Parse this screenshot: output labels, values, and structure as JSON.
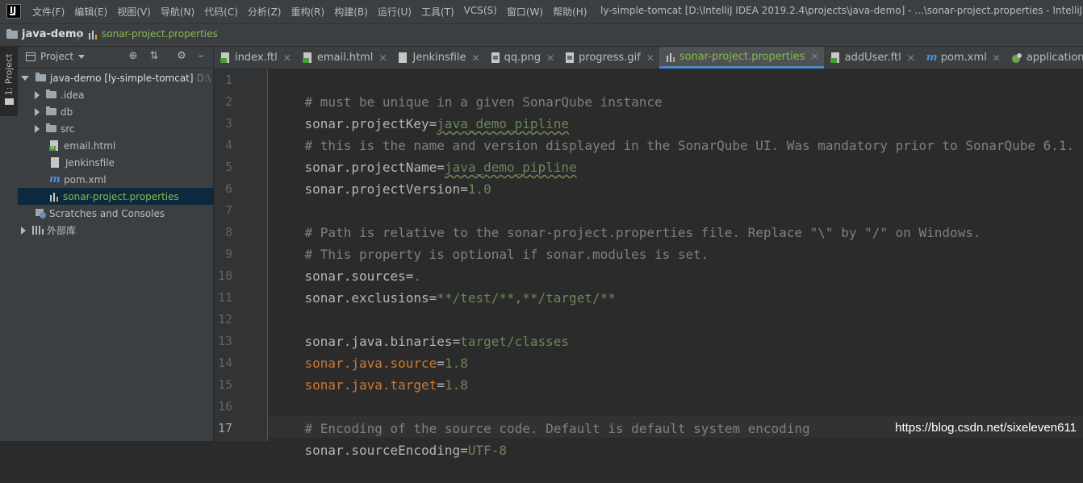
{
  "menubar": {
    "items": [
      "文件(F)",
      "编辑(E)",
      "视图(V)",
      "导航(N)",
      "代码(C)",
      "分析(Z)",
      "重构(R)",
      "构建(B)",
      "运行(U)",
      "工具(T)",
      "VCS(S)",
      "窗口(W)",
      "帮助(H)"
    ],
    "window_title": "ly-simple-tomcat [D:\\IntelliJ IDEA 2019.2.4\\projects\\java-demo] - ...\\sonar-project.properties - IntelliJ ID"
  },
  "navbar": {
    "project": "java-demo",
    "file": "sonar-project.properties"
  },
  "tool_stripe": {
    "project_label": "1: Project"
  },
  "project_panel": {
    "title": "Project",
    "tree": {
      "root_name": "java-demo [ly-simple-tomcat]",
      "root_hint": "D:\\",
      "items": [
        ".idea",
        "db",
        "src",
        "email.html",
        "Jenkinsfile",
        "pom.xml",
        "sonar-project.properties",
        "Scratches and Consoles",
        "外部库"
      ]
    }
  },
  "tabs": [
    "index.ftl",
    "email.html",
    "Jenkinsfile",
    "qq.png",
    "progress.gif",
    "sonar-project.properties",
    "addUser.ftl",
    "pom.xml",
    "application.yml"
  ],
  "editor": {
    "line_numbers": [
      "1",
      "2",
      "3",
      "4",
      "5",
      "6",
      "7",
      "8",
      "9",
      "10",
      "11",
      "12",
      "13",
      "14",
      "15",
      "16",
      "17"
    ],
    "lines": {
      "l1": "# must be unique in a given SonarQube instance",
      "l2_key": "sonar.projectKey",
      "l2_val": "java_demo_pipline",
      "l3": "# this is the name and version displayed in the SonarQube UI. Was mandatory prior to SonarQube 6.1.",
      "l4_key": "sonar.projectName",
      "l4_val": "java_demo_pipline",
      "l5_key": "sonar.projectVersion",
      "l5_val": "1.0",
      "l7": "# Path is relative to the sonar-project.properties file. Replace \"\\\" by \"/\" on Windows.",
      "l8": "# This property is optional if sonar.modules is set.",
      "l9_key": "sonar.sources",
      "l9_val": ".",
      "l10_key": "sonar.exclusions",
      "l10_val": "**/test/**,**/target/**",
      "l12_key": "sonar.java.binaries",
      "l12_val": "target/classes",
      "l13_key": "sonar.java.source",
      "l13_val": "1.8",
      "l14_key": "sonar.java.target",
      "l14_val": "1.8",
      "l16": "# Encoding of the source code. Default is default system encoding",
      "l17_key": "sonar.sourceEncoding",
      "l17_val": "UTF-8"
    },
    "equals": "="
  },
  "watermark": "https://blog.csdn.net/sixeleven611"
}
